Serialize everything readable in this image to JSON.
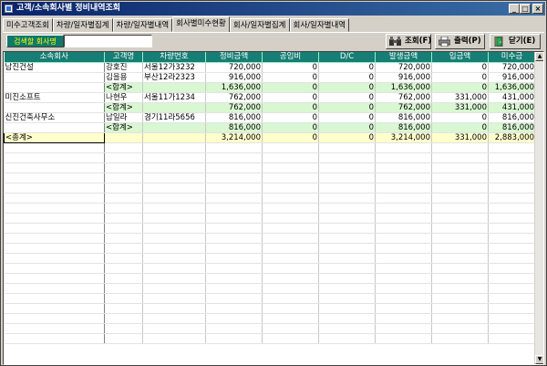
{
  "window": {
    "title": "고객/소속회사별 정비내역조회",
    "minimize_label": "_",
    "maximize_label": "□",
    "close_label": "×"
  },
  "tabs": [
    {
      "label": "미수고객조회",
      "active": false
    },
    {
      "label": "차량/일자별집계",
      "active": false
    },
    {
      "label": "차량/일자별내역",
      "active": false
    },
    {
      "label": "회사별미수현황",
      "active": true
    },
    {
      "label": "회사/일자별집계",
      "active": false
    },
    {
      "label": "회사/일자별내역",
      "active": false
    }
  ],
  "toolbar": {
    "search_label": "검색할 회사명",
    "search_value": "",
    "search_button": "조회(F)",
    "print_button": "출력(P)",
    "close_button": "닫기(E)"
  },
  "table": {
    "columns": [
      "소속회사",
      "고객명",
      "차량번호",
      "정비금액",
      "공임비",
      "D/C",
      "발생금액",
      "입금액",
      "미수금"
    ],
    "rows": [
      {
        "type": "data",
        "cells": [
          "남진건설",
          "강호진",
          "서울12가3232",
          "720,000",
          "0",
          "0",
          "720,000",
          "0",
          "720,000"
        ]
      },
      {
        "type": "data",
        "cells": [
          "",
          "김을용",
          "부산12라2323",
          "916,000",
          "0",
          "0",
          "916,000",
          "0",
          "916,000"
        ]
      },
      {
        "type": "sub",
        "cells": [
          "",
          "<합계>",
          "",
          "1,636,000",
          "0",
          "0",
          "1,636,000",
          "0",
          "1,636,000"
        ]
      },
      {
        "type": "data",
        "cells": [
          "미진소프트",
          "나현우",
          "서울11가1234",
          "762,000",
          "0",
          "0",
          "762,000",
          "331,000",
          "431,000"
        ]
      },
      {
        "type": "sub",
        "cells": [
          "",
          "<합계>",
          "",
          "762,000",
          "0",
          "0",
          "762,000",
          "331,000",
          "431,000"
        ]
      },
      {
        "type": "data",
        "cells": [
          "신진건축사무소",
          "남일라",
          "경기11라5656",
          "816,000",
          "0",
          "0",
          "816,000",
          "0",
          "816,000"
        ]
      },
      {
        "type": "sub",
        "cells": [
          "",
          "<합계>",
          "",
          "816,000",
          "0",
          "0",
          "816,000",
          "0",
          "816,000"
        ]
      },
      {
        "type": "total",
        "cells": [
          "<총계>",
          "",
          "",
          "3,214,000",
          "0",
          "0",
          "3,214,000",
          "331,000",
          "2,883,000"
        ]
      }
    ],
    "empty_rows": 20
  },
  "colors": {
    "header_bg": "#167e74",
    "subtotal_bg": "#d9f7d2",
    "total_bg": "#ffffcc",
    "title_bar": "#0a246a"
  },
  "icons": {
    "search_button": "binoculars-icon",
    "print_button": "printer-icon",
    "close_button": "door-exit-icon"
  }
}
